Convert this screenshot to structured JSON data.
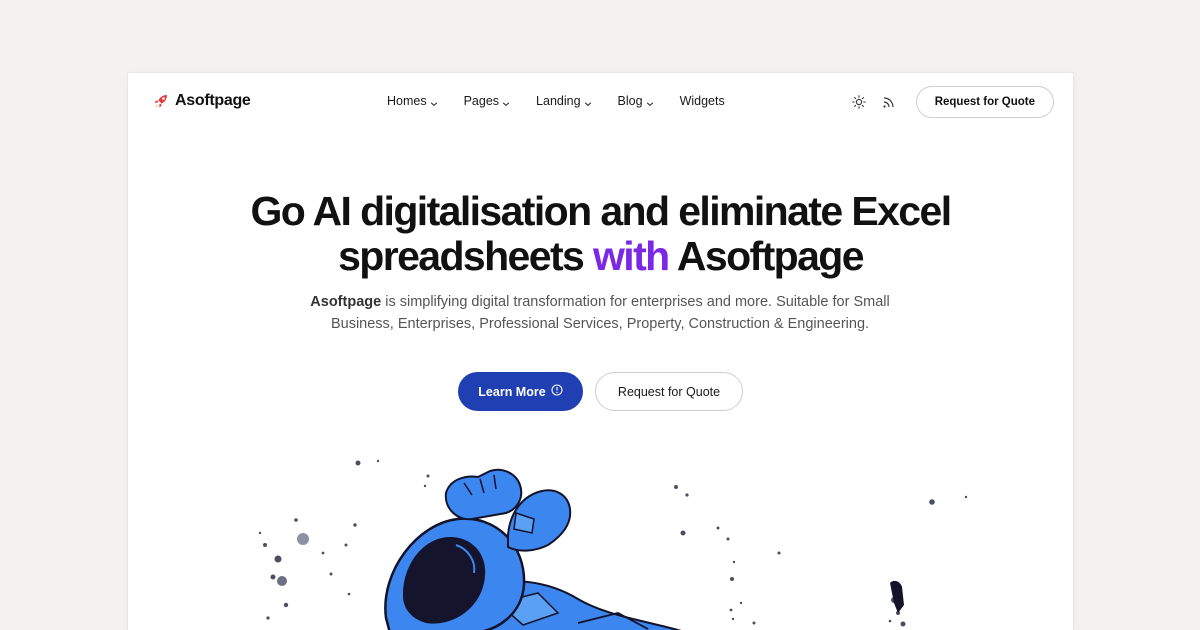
{
  "brand": {
    "name": "Asoftpage",
    "icon": "rocket-icon"
  },
  "nav": {
    "items": [
      {
        "label": "Homes",
        "dropdown": true
      },
      {
        "label": "Pages",
        "dropdown": true
      },
      {
        "label": "Landing",
        "dropdown": true
      },
      {
        "label": "Blog",
        "dropdown": true
      },
      {
        "label": "Widgets",
        "dropdown": false
      }
    ]
  },
  "header": {
    "theme_icon": "sun-icon",
    "rss_icon": "rss-icon",
    "quote_label": "Request for Quote"
  },
  "hero": {
    "title_line1": "Go AI digitalisation and eliminate Excel",
    "title_line2_pre": "spreadsheets ",
    "title_line2_accent": "with",
    "title_line2_post": " Asoftpage",
    "desc_brand": "Asoftpage",
    "desc_text": " is simplifying digital transformation for enterprises and more. Suitable for Small Business, Enterprises, Professional Services, Property, Construction & Engineering.",
    "primary_label": "Learn More",
    "primary_icon": "info-circle-icon",
    "secondary_label": "Request for Quote"
  },
  "colors": {
    "accent": "#7a28e6",
    "primary_button": "#1f3fb3",
    "background": "#f3f2f0",
    "astronaut": "#3c86f0"
  },
  "illustration": {
    "name": "astronaut-illustration"
  }
}
